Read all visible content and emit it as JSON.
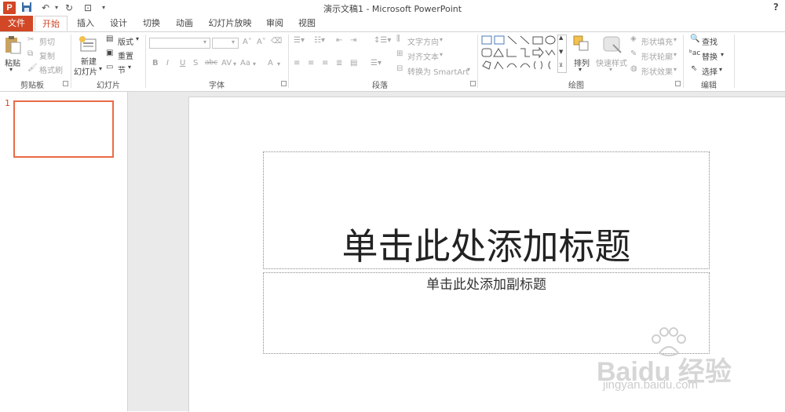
{
  "window": {
    "title": "演示文稿1 - Microsoft PowerPoint",
    "help": "?"
  },
  "quick_access": {
    "logo": "P"
  },
  "tabs": [
    "文件",
    "开始",
    "插入",
    "设计",
    "切换",
    "动画",
    "幻灯片放映",
    "审阅",
    "视图"
  ],
  "ribbon": {
    "clipboard": {
      "paste": "粘贴",
      "cut": "剪切",
      "copy": "复制",
      "format_painter": "格式刷",
      "label": "剪贴板"
    },
    "slides": {
      "new_slide_line1": "新建",
      "new_slide_line2": "幻灯片",
      "layout": "版式",
      "reset": "重置",
      "section": "节",
      "label": "幻灯片"
    },
    "font": {
      "label": "字体",
      "bold": "B",
      "italic": "I",
      "underline": "U",
      "shadow": "S",
      "strike": "abc",
      "spacing": "AV",
      "case": "Aa",
      "color": "A",
      "grow": "A˄",
      "shrink": "A˅"
    },
    "paragraph": {
      "text_direction": "文字方向",
      "align_text": "对齐文本",
      "smartart": "转换为 SmartArt",
      "label": "段落"
    },
    "drawing": {
      "arrange": "排列",
      "quick_styles": "快速样式",
      "shape_fill": "形状填充",
      "shape_outline": "形状轮廓",
      "shape_effects": "形状效果",
      "label": "绘图"
    },
    "editing": {
      "find": "查找",
      "replace": "替换",
      "select": "选择",
      "label": "编辑"
    }
  },
  "thumbnails": {
    "slide_number": "1"
  },
  "slide": {
    "title_placeholder": "单击此处添加标题",
    "subtitle_placeholder": "单击此处添加副标题"
  },
  "watermark": {
    "brand": "Baidu 经验",
    "url": "jingyan.baidu.com"
  },
  "colors": {
    "accent": "#d24726",
    "thumb_border": "#ea6b47"
  }
}
